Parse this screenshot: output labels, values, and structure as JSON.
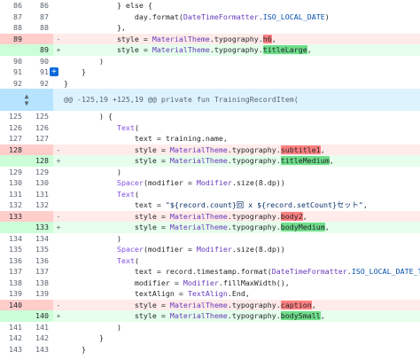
{
  "lines": [
    {
      "type": "ctx",
      "old": "86",
      "new": "86",
      "sign": "",
      "segs": [
        {
          "t": "            } else {"
        }
      ]
    },
    {
      "type": "ctx",
      "old": "87",
      "new": "87",
      "sign": "",
      "segs": [
        {
          "t": "                day.format("
        },
        {
          "t": "DateTimeFormatter",
          "c": "cls"
        },
        {
          "t": "."
        },
        {
          "t": "ISO_LOCAL_DATE",
          "c": "num"
        },
        {
          "t": ")"
        }
      ]
    },
    {
      "type": "ctx",
      "old": "88",
      "new": "88",
      "sign": "",
      "segs": [
        {
          "t": "            },"
        }
      ]
    },
    {
      "type": "del",
      "old": "89",
      "new": "",
      "sign": "-",
      "segs": [
        {
          "t": "            style = "
        },
        {
          "t": "MaterialTheme",
          "c": "cls"
        },
        {
          "t": ".typography."
        },
        {
          "t": "h6",
          "c": "hl-del"
        },
        {
          "t": ","
        }
      ]
    },
    {
      "type": "add",
      "old": "",
      "new": "89",
      "sign": "+",
      "segs": [
        {
          "t": "            style = "
        },
        {
          "t": "MaterialTheme",
          "c": "cls"
        },
        {
          "t": ".typography."
        },
        {
          "t": "titleLarge",
          "c": "hl-add"
        },
        {
          "t": ","
        }
      ]
    },
    {
      "type": "ctx",
      "old": "90",
      "new": "90",
      "sign": "",
      "segs": [
        {
          "t": "        )"
        }
      ]
    },
    {
      "type": "ctx",
      "old": "91",
      "new": "91",
      "sign": "",
      "btn": true,
      "segs": [
        {
          "t": "    }"
        }
      ]
    },
    {
      "type": "ctx",
      "old": "92",
      "new": "92",
      "sign": "",
      "segs": [
        {
          "t": "}"
        }
      ]
    },
    {
      "type": "hunk",
      "segs": [
        {
          "t": "@@ -125,19 +125,19 @@ private fun TrainingRecordItem("
        }
      ]
    },
    {
      "type": "ctx",
      "old": "125",
      "new": "125",
      "sign": "",
      "segs": [
        {
          "t": "        ) {"
        }
      ]
    },
    {
      "type": "ctx",
      "old": "126",
      "new": "126",
      "sign": "",
      "segs": [
        {
          "t": "            "
        },
        {
          "t": "Text",
          "c": "fn"
        },
        {
          "t": "("
        }
      ]
    },
    {
      "type": "ctx",
      "old": "127",
      "new": "127",
      "sign": "",
      "segs": [
        {
          "t": "                text = training.name,"
        }
      ]
    },
    {
      "type": "del",
      "old": "128",
      "new": "",
      "sign": "-",
      "segs": [
        {
          "t": "                style = "
        },
        {
          "t": "MaterialTheme",
          "c": "cls"
        },
        {
          "t": ".typography."
        },
        {
          "t": "subtitle1",
          "c": "hl-del"
        },
        {
          "t": ","
        }
      ]
    },
    {
      "type": "add",
      "old": "",
      "new": "128",
      "sign": "+",
      "segs": [
        {
          "t": "                style = "
        },
        {
          "t": "MaterialTheme",
          "c": "cls"
        },
        {
          "t": ".typography."
        },
        {
          "t": "titleMedium",
          "c": "hl-add"
        },
        {
          "t": ","
        }
      ]
    },
    {
      "type": "ctx",
      "old": "129",
      "new": "129",
      "sign": "",
      "segs": [
        {
          "t": "            )"
        }
      ]
    },
    {
      "type": "ctx",
      "old": "130",
      "new": "130",
      "sign": "",
      "segs": [
        {
          "t": "            "
        },
        {
          "t": "Spacer",
          "c": "fn"
        },
        {
          "t": "(modifier = "
        },
        {
          "t": "Modifier",
          "c": "cls"
        },
        {
          "t": ".size(8.dp))"
        }
      ]
    },
    {
      "type": "ctx",
      "old": "131",
      "new": "131",
      "sign": "",
      "segs": [
        {
          "t": "            "
        },
        {
          "t": "Text",
          "c": "fn"
        },
        {
          "t": "("
        }
      ]
    },
    {
      "type": "ctx",
      "old": "132",
      "new": "132",
      "sign": "",
      "segs": [
        {
          "t": "                text = "
        },
        {
          "t": "\"${record.count}回 x ${record.setCount}セット\"",
          "c": "str"
        },
        {
          "t": ","
        }
      ]
    },
    {
      "type": "del",
      "old": "133",
      "new": "",
      "sign": "-",
      "segs": [
        {
          "t": "                style = "
        },
        {
          "t": "MaterialTheme",
          "c": "cls"
        },
        {
          "t": ".typography."
        },
        {
          "t": "body2",
          "c": "hl-del"
        },
        {
          "t": ","
        }
      ]
    },
    {
      "type": "add",
      "old": "",
      "new": "133",
      "sign": "+",
      "segs": [
        {
          "t": "                style = "
        },
        {
          "t": "MaterialTheme",
          "c": "cls"
        },
        {
          "t": ".typography."
        },
        {
          "t": "bodyMedium",
          "c": "hl-add"
        },
        {
          "t": ","
        }
      ]
    },
    {
      "type": "ctx",
      "old": "134",
      "new": "134",
      "sign": "",
      "segs": [
        {
          "t": "            )"
        }
      ]
    },
    {
      "type": "ctx",
      "old": "135",
      "new": "135",
      "sign": "",
      "segs": [
        {
          "t": "            "
        },
        {
          "t": "Spacer",
          "c": "fn"
        },
        {
          "t": "(modifier = "
        },
        {
          "t": "Modifier",
          "c": "cls"
        },
        {
          "t": ".size(8.dp))"
        }
      ]
    },
    {
      "type": "ctx",
      "old": "136",
      "new": "136",
      "sign": "",
      "segs": [
        {
          "t": "            "
        },
        {
          "t": "Text",
          "c": "fn"
        },
        {
          "t": "("
        }
      ]
    },
    {
      "type": "ctx",
      "old": "137",
      "new": "137",
      "sign": "",
      "segs": [
        {
          "t": "                text = record.timestamp.format("
        },
        {
          "t": "DateTimeFormatter",
          "c": "cls"
        },
        {
          "t": "."
        },
        {
          "t": "ISO_LOCAL_DATE_TIME",
          "c": "num"
        },
        {
          "t": "),"
        }
      ]
    },
    {
      "type": "ctx",
      "old": "138",
      "new": "138",
      "sign": "",
      "segs": [
        {
          "t": "                modifier = "
        },
        {
          "t": "Modifier",
          "c": "cls"
        },
        {
          "t": ".fillMaxWidth(),"
        }
      ]
    },
    {
      "type": "ctx",
      "old": "139",
      "new": "139",
      "sign": "",
      "segs": [
        {
          "t": "                textAlign = "
        },
        {
          "t": "TextAlign",
          "c": "cls"
        },
        {
          "t": ".End,"
        }
      ]
    },
    {
      "type": "del",
      "old": "140",
      "new": "",
      "sign": "-",
      "segs": [
        {
          "t": "                style = "
        },
        {
          "t": "MaterialTheme",
          "c": "cls"
        },
        {
          "t": ".typography."
        },
        {
          "t": "caption",
          "c": "hl-del"
        },
        {
          "t": ","
        }
      ]
    },
    {
      "type": "add",
      "old": "",
      "new": "140",
      "sign": "+",
      "segs": [
        {
          "t": "                style = "
        },
        {
          "t": "MaterialTheme",
          "c": "cls"
        },
        {
          "t": ".typography."
        },
        {
          "t": "bodySmall",
          "c": "hl-add"
        },
        {
          "t": ","
        }
      ]
    },
    {
      "type": "ctx",
      "old": "141",
      "new": "141",
      "sign": "",
      "segs": [
        {
          "t": "            )"
        }
      ]
    },
    {
      "type": "ctx",
      "old": "142",
      "new": "142",
      "sign": "",
      "segs": [
        {
          "t": "        }"
        }
      ]
    },
    {
      "type": "ctx",
      "old": "143",
      "new": "143",
      "sign": "",
      "segs": [
        {
          "t": "    }"
        }
      ]
    }
  ],
  "icons": {
    "expand_up": "▲",
    "expand_down": "▼",
    "add_comment": "+"
  }
}
